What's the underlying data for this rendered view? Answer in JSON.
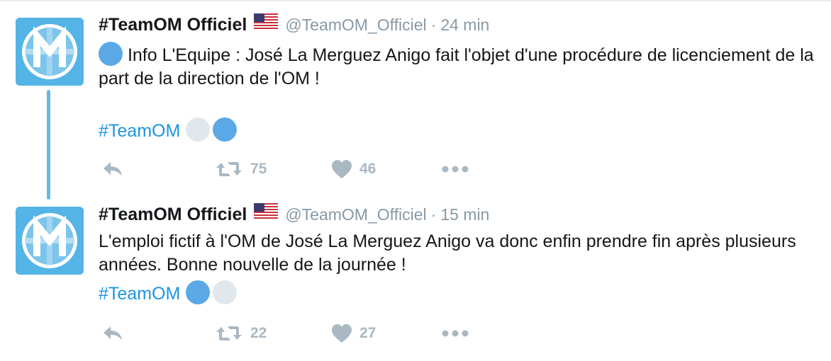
{
  "tweets": [
    {
      "name": "#TeamOM Officiel",
      "handle": "@TeamOM_Officiel",
      "separator": "·",
      "time": "24 min",
      "text": "Info L'Equipe : José La Merguez Anigo fait l'objet d'une procédure de licenciement de la part de la direction de l'OM !",
      "hashtag": "#TeamOM",
      "retweets": "75",
      "likes": "46"
    },
    {
      "name": "#TeamOM Officiel",
      "handle": "@TeamOM_Officiel",
      "separator": "·",
      "time": "15 min",
      "text": "L'emploi fictif à l'OM de José La Merguez Anigo va donc enfin prendre fin après plusieurs années. Bonne nouvelle de la journée !",
      "hashtag": "#TeamOM",
      "retweets": "22",
      "likes": "27"
    }
  ],
  "icons": {
    "avatar": "om-logo-icon",
    "flag": "us-flag-icon",
    "reply": "reply-icon",
    "retweet": "retweet-icon",
    "like": "heart-icon",
    "more": "more-dots-icon"
  },
  "colors": {
    "link": "#1b95e0",
    "muted": "#8899a6",
    "action": "#aab8c2",
    "avatar": "#54b4e6",
    "thread": "#65b8e4"
  }
}
